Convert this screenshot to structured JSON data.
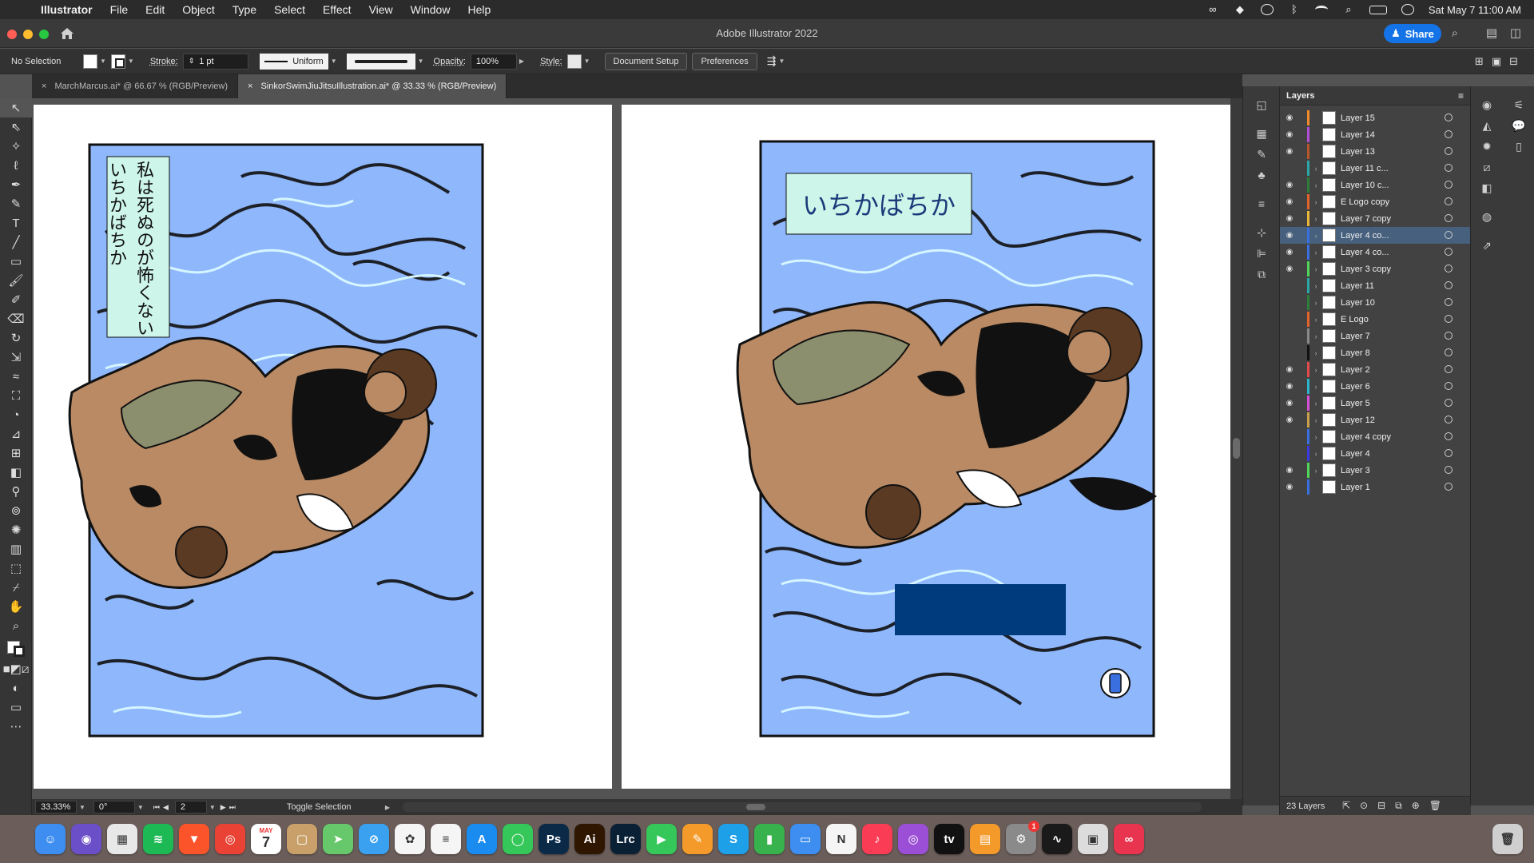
{
  "menubar": {
    "app_name": "Illustrator",
    "items": [
      "File",
      "Edit",
      "Object",
      "Type",
      "Select",
      "Effect",
      "View",
      "Window",
      "Help"
    ],
    "datetime": "Sat May 7  11:00 AM"
  },
  "titlebar": {
    "title": "Adobe Illustrator 2022",
    "share_label": "Share"
  },
  "controlbar": {
    "selection": "No Selection",
    "stroke_label": "Stroke:",
    "stroke_value": "1 pt",
    "profile": "Uniform",
    "opacity_label": "Opacity:",
    "opacity_value": "100%",
    "style_label": "Style:",
    "document_setup": "Document Setup",
    "preferences": "Preferences"
  },
  "tabs": [
    {
      "label": "MarchMarcus.ai* @ 66.67 % (RGB/Preview)",
      "active": false
    },
    {
      "label": "SinkorSwimJiuJitsuIllustration.ai* @ 33.33 % (RGB/Preview)",
      "active": true
    }
  ],
  "artboards": {
    "left_text_line1": "私は死ぬのが怖くない",
    "left_text_line2": "いちかばちか",
    "right_title": "いちかばちか",
    "colors": {
      "sky": "#8fb7fc",
      "label_bg": "#cdf5e9",
      "navy": "#003c7d"
    }
  },
  "statusbar": {
    "zoom": "33.33%",
    "rotation": "0°",
    "artboard_number": "2",
    "mode": "Toggle Selection"
  },
  "layers_panel": {
    "title": "Layers",
    "count_label": "23 Layers",
    "layers": [
      {
        "name": "Layer 15",
        "visible": true,
        "color": "#f28a2b",
        "expandable": false,
        "selected": false
      },
      {
        "name": "Layer 14",
        "visible": true,
        "color": "#b04fd6",
        "expandable": false,
        "selected": false
      },
      {
        "name": "Layer 13",
        "visible": true,
        "color": "#b5552a",
        "expandable": false,
        "selected": false
      },
      {
        "name": "Layer 11 c...",
        "visible": false,
        "color": "#2aa6a6",
        "expandable": true,
        "selected": false
      },
      {
        "name": "Layer 10 c...",
        "visible": true,
        "color": "#2f7d3a",
        "expandable": true,
        "selected": false
      },
      {
        "name": "E Logo copy",
        "visible": true,
        "color": "#e0632a",
        "expandable": true,
        "selected": false
      },
      {
        "name": "Layer 7 copy",
        "visible": true,
        "color": "#e6b63a",
        "expandable": true,
        "selected": false
      },
      {
        "name": "Layer 4 co...",
        "visible": true,
        "color": "#3a6fe0",
        "expandable": true,
        "selected": true
      },
      {
        "name": "Layer 4 co...",
        "visible": true,
        "color": "#3a6fe0",
        "expandable": true,
        "selected": false
      },
      {
        "name": "Layer 3 copy",
        "visible": true,
        "color": "#4fd65a",
        "expandable": true,
        "selected": false
      },
      {
        "name": "Layer 11",
        "visible": false,
        "color": "#2aa6a6",
        "expandable": true,
        "selected": false
      },
      {
        "name": "Layer 10",
        "visible": false,
        "color": "#2f7d3a",
        "expandable": true,
        "selected": false
      },
      {
        "name": "E Logo",
        "visible": false,
        "color": "#e0632a",
        "expandable": true,
        "selected": false
      },
      {
        "name": "Layer 7",
        "visible": false,
        "color": "#888888",
        "expandable": true,
        "selected": false
      },
      {
        "name": "Layer 8",
        "visible": false,
        "color": "#111111",
        "expandable": true,
        "selected": false
      },
      {
        "name": "Layer 2",
        "visible": true,
        "color": "#e04a4a",
        "expandable": true,
        "selected": false
      },
      {
        "name": "Layer 6",
        "visible": true,
        "color": "#2ab6c8",
        "expandable": true,
        "selected": false
      },
      {
        "name": "Layer 5",
        "visible": true,
        "color": "#d64fd6",
        "expandable": true,
        "selected": false
      },
      {
        "name": "Layer 12",
        "visible": true,
        "color": "#c8a04a",
        "expandable": true,
        "selected": false
      },
      {
        "name": "Layer 4 copy",
        "visible": false,
        "color": "#3a6fe0",
        "expandable": true,
        "selected": false
      },
      {
        "name": "Layer 4",
        "visible": false,
        "color": "#3a3ae0",
        "expandable": true,
        "selected": false
      },
      {
        "name": "Layer 3",
        "visible": true,
        "color": "#4fd65a",
        "expandable": true,
        "selected": false
      },
      {
        "name": "Layer 1",
        "visible": true,
        "color": "#3a6fe0",
        "expandable": false,
        "selected": false
      }
    ]
  },
  "dock": {
    "calendar_day": "7",
    "calendar_month": "MAY",
    "settings_badge": "1",
    "apps": [
      {
        "icon": "finder-icon",
        "glyph": "☺",
        "color": "#3d8ef0"
      },
      {
        "icon": "siri-icon",
        "glyph": "◉",
        "color": "#6b4fc8"
      },
      {
        "icon": "launchpad-icon",
        "glyph": "▦",
        "color": "#e8e8e8"
      },
      {
        "icon": "spotify-icon",
        "glyph": "≋",
        "color": "#1db954"
      },
      {
        "icon": "brave-icon",
        "glyph": "▼",
        "color": "#fb542b"
      },
      {
        "icon": "chrome-icon",
        "glyph": "◎",
        "color": "#ea4335"
      },
      {
        "icon": "calendar-icon",
        "glyph": "",
        "color": "#ffffff"
      },
      {
        "icon": "contacts-icon",
        "glyph": "▢",
        "color": "#c9a06a"
      },
      {
        "icon": "maps-icon",
        "glyph": "➤",
        "color": "#67c86b"
      },
      {
        "icon": "safari-icon",
        "glyph": "⊘",
        "color": "#3aa0f0"
      },
      {
        "icon": "photos-icon",
        "glyph": "✿",
        "color": "#f5f5f5"
      },
      {
        "icon": "reminders-icon",
        "glyph": "≡",
        "color": "#f5f5f5"
      },
      {
        "icon": "app-store-icon",
        "glyph": "A",
        "color": "#1a8cf0"
      },
      {
        "icon": "messages-icon",
        "glyph": "◯",
        "color": "#35c759"
      },
      {
        "icon": "photoshop-icon",
        "glyph": "Ps",
        "color": "#0b2a48"
      },
      {
        "icon": "illustrator-icon",
        "glyph": "Ai",
        "color": "#2e1600"
      },
      {
        "icon": "lightroom-classic-icon",
        "glyph": "Lrc",
        "color": "#0a2035"
      },
      {
        "icon": "facetime-icon",
        "glyph": "▶",
        "color": "#35c759"
      },
      {
        "icon": "pages-icon",
        "glyph": "✎",
        "color": "#f39a2b"
      },
      {
        "icon": "skype-icon",
        "glyph": "S",
        "color": "#1ea0e8"
      },
      {
        "icon": "numbers-icon",
        "glyph": "▮",
        "color": "#37b24d"
      },
      {
        "icon": "keynote-icon",
        "glyph": "▭",
        "color": "#3d8ef0"
      },
      {
        "icon": "news-icon",
        "glyph": "N",
        "color": "#f5f5f5"
      },
      {
        "icon": "music-icon",
        "glyph": "♪",
        "color": "#fa3c55"
      },
      {
        "icon": "podcasts-icon",
        "glyph": "◎",
        "color": "#9b4fd6"
      },
      {
        "icon": "apple-tv-icon",
        "glyph": "tv",
        "color": "#111111"
      },
      {
        "icon": "books-icon",
        "glyph": "▤",
        "color": "#f39a2b"
      },
      {
        "icon": "system-preferences-icon",
        "glyph": "⚙",
        "color": "#8a8a8a"
      },
      {
        "icon": "activity-monitor-icon",
        "glyph": "∿",
        "color": "#1a1a1a"
      },
      {
        "icon": "screenshot-icon",
        "glyph": "▣",
        "color": "#dcdcdc"
      },
      {
        "icon": "creative-cloud-icon",
        "glyph": "∞",
        "color": "#e8344e"
      }
    ]
  }
}
